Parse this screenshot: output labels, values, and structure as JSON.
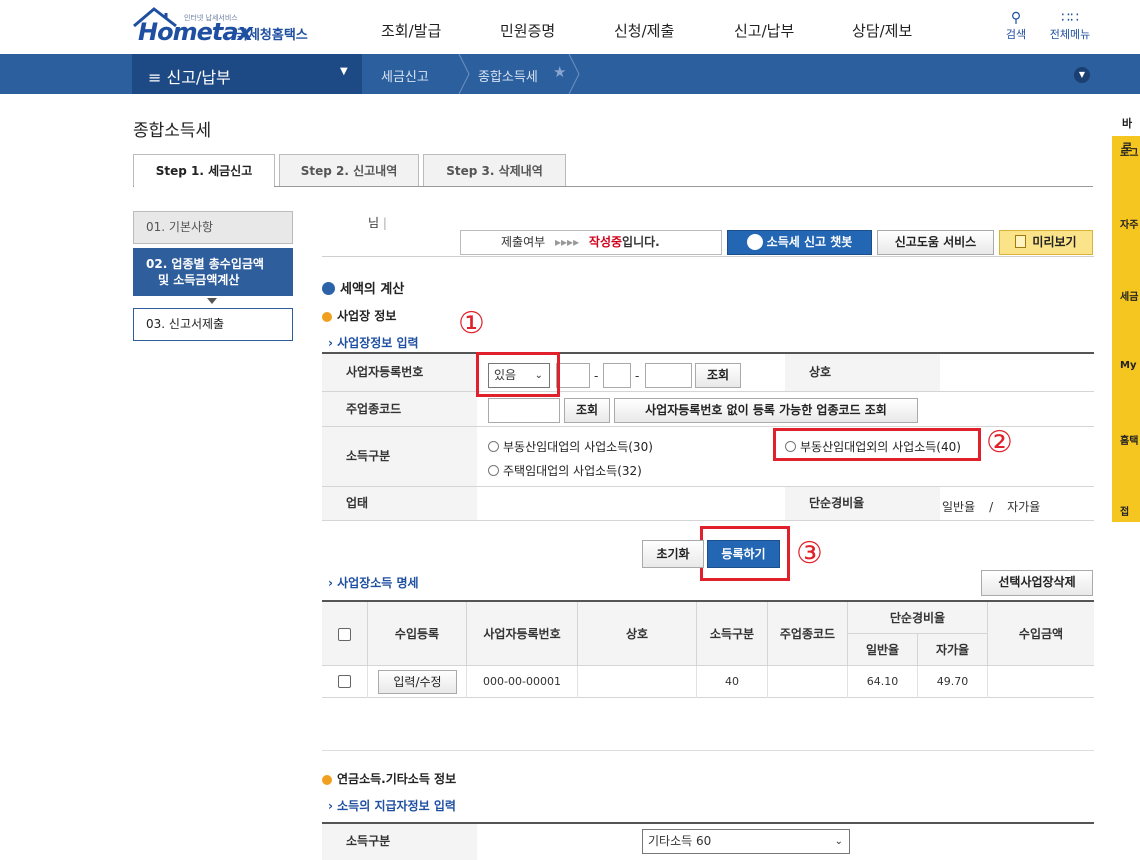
{
  "header": {
    "logo_small": "인터넷 납세서비스",
    "logo_main": "Hometax",
    "logo_korean": "국세청홈택스",
    "nav": [
      "조회/발급",
      "민원증명",
      "신청/제출",
      "신고/납부",
      "상담/제보"
    ],
    "search_label": "검색",
    "allmenu_label": "전체메뉴"
  },
  "menubar": {
    "title": "신고/납부",
    "crumbs": [
      "세금신고",
      "종합소득세"
    ]
  },
  "page_title": "종합소득세",
  "tabs": [
    "Step 1. 세금신고",
    "Step 2. 신고내역",
    "Step 3. 삭제내역"
  ],
  "steps": {
    "step1": "01. 기본사항",
    "step2_line1": "02. 업종별 총수입금액",
    "step2_line2": "및 소득금액계산",
    "step3": "03. 신고서제출"
  },
  "status": {
    "name_suffix": "님",
    "submit_label": "제출여부",
    "arrows": "▸▸▸▸",
    "state_red": "작성중",
    "state_suffix": "입니다.",
    "chatbot_button": "소득세 신고 챗봇",
    "help_button": "신고도움 서비스",
    "preview_button": "미리보기"
  },
  "section": {
    "tax_calc": "세액의 계산",
    "business_info": "사업장 정보",
    "business_input": "사업장정보 입력",
    "business_income_detail": "사업장소득 명세",
    "pension_info": "연금소득.기타소득 정보",
    "payer_input": "소득의 지급자정보 입력"
  },
  "form": {
    "biz_reg_label": "사업자등록번호",
    "biz_reg_select": "있음",
    "query_button": "조회",
    "sangho_label": "상호",
    "industry_code_label": "주업종코드",
    "industry_query_button": "조회",
    "industry_no_reg_button": "사업자등록번호 없이 등록 가능한 업종코드 조회",
    "income_type_label": "소득구분",
    "radio_30": "부동산임대업의 사업소득(30)",
    "radio_40": "부동산임대업외의 사업소득(40)",
    "radio_32": "주택임대업의 사업소득(32)",
    "uptae_label": "업태",
    "simple_rate_label": "단순경비율",
    "general_rate": "일반율",
    "rate_sep": "/",
    "self_rate": "자가율",
    "reset_button": "초기화",
    "register_button": "등록하기",
    "markers": [
      "①",
      "②",
      "③"
    ]
  },
  "list": {
    "delete_selected_button": "선택사업장삭제",
    "headers": {
      "income_register": "수입등록",
      "biz_reg_no": "사업자등록번호",
      "sangho": "상호",
      "income_type": "소득구분",
      "industry_code": "주업종코드",
      "simple_rate": "단순경비율",
      "general": "일반율",
      "self": "자가율",
      "income_amount": "수입금액"
    },
    "rows": [
      {
        "edit_button": "입력/수정",
        "biz_reg_no": "000-00-00001",
        "sangho": "",
        "income_type": "40",
        "industry_code": "",
        "general": "64.10",
        "self": "49.70",
        "income_amount": ""
      }
    ]
  },
  "pension": {
    "income_type_label": "소득구분",
    "income_type_select": "기타소득 60"
  },
  "quickbar": {
    "top": "바로",
    "items": [
      "로그",
      "자주",
      "세금",
      "My",
      "홈택",
      "접"
    ]
  }
}
